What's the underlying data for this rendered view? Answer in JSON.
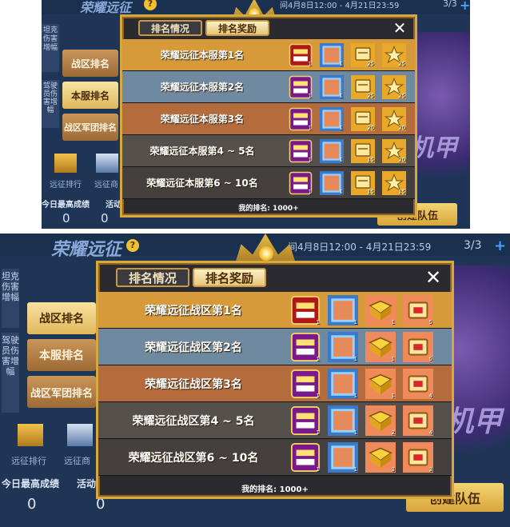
{
  "colors": {
    "row_gold": "#d69a3a",
    "row_slate": "#6f8aa0",
    "row_copper": "#b46c3c",
    "row_grey": "#55504c",
    "row_dark": "#45403d",
    "modal_gold": "#d8a840"
  },
  "top_screen": {
    "title": "荣耀远征",
    "time_range": "间4月8日12:00 - 4月21日23:59",
    "page_indicator": "3/3",
    "side_vertical_1": "坦克伤害增幅",
    "side_vertical_2": "驾驶员伤害增幅",
    "side_tabs": [
      "战区排名",
      "本服排名",
      "战区军团排名"
    ],
    "mini_icons": [
      "远征排行",
      "远征商"
    ],
    "stat_label": "今日最高成绩",
    "stat_label_2": "活动",
    "stat_value": "0",
    "team_button": "创建队伍",
    "mecha_text": "机甲",
    "modal": {
      "tabs": [
        "排名情况",
        "排名奖励"
      ],
      "close": "✕",
      "my_rank": "我的排名:  1000+",
      "rows": [
        {
          "title": "荣耀远征本服第1名",
          "rewards": [
            {
              "icon": "title-tianxia-icon",
              "count": "1"
            },
            {
              "icon": "frame-icon",
              "count": "1"
            },
            {
              "icon": "note-icon",
              "count": "25"
            },
            {
              "icon": "star-icon",
              "count": "25"
            }
          ]
        },
        {
          "title": "荣耀远征本服第2名",
          "rewards": [
            {
              "icon": "title-bazhu-icon",
              "count": "1"
            },
            {
              "icon": "frame-icon",
              "count": "1"
            },
            {
              "icon": "note-icon",
              "count": "25"
            },
            {
              "icon": "star-icon",
              "count": "25"
            }
          ]
        },
        {
          "title": "荣耀远征本服第3名",
          "rewards": [
            {
              "icon": "title-bazhu-icon",
              "count": "1"
            },
            {
              "icon": "frame-icon",
              "count": "1"
            },
            {
              "icon": "note-icon",
              "count": "20"
            },
            {
              "icon": "star-icon",
              "count": "20"
            }
          ]
        },
        {
          "title": "荣耀远征本服第4 ~ 5名",
          "rewards": [
            {
              "icon": "title-bazhu-icon",
              "count": "1"
            },
            {
              "icon": "frame-icon",
              "count": "1"
            },
            {
              "icon": "note-icon",
              "count": "15"
            },
            {
              "icon": "star-icon",
              "count": "20"
            }
          ]
        },
        {
          "title": "荣耀远征本服第6 ~ 10名",
          "rewards": [
            {
              "icon": "title-bazhu-icon",
              "count": "1"
            },
            {
              "icon": "frame-icon",
              "count": "1"
            },
            {
              "icon": "note-icon",
              "count": "15"
            },
            {
              "icon": "star-icon",
              "count": "15"
            }
          ]
        }
      ]
    }
  },
  "bottom_screen": {
    "title": "荣耀远征",
    "time_range": "间4月8日12:00 - 4月21日23:59",
    "page_indicator": "3/3",
    "side_vertical_1": "坦克伤害增幅",
    "side_vertical_2": "驾驶员伤害增幅",
    "side_tabs": [
      "战区排名",
      "本服排名",
      "战区军团排名"
    ],
    "mini_icons": [
      "远征排行",
      "远征商"
    ],
    "stat_label": "今日最高成绩",
    "stat_label_2": "活动",
    "stat_value": "0",
    "team_button": "创建队伍",
    "mecha_text": "机甲",
    "modal": {
      "tabs": [
        "排名情况",
        "排名奖励"
      ],
      "close": "✕",
      "my_rank": "我的排名:  1000+",
      "rows": [
        {
          "title": "荣耀远征战区第1名",
          "rewards": [
            {
              "icon": "title-tianxia-icon",
              "count": "1"
            },
            {
              "icon": "frame-icon",
              "count": "1"
            },
            {
              "icon": "book-icon",
              "count": "1"
            },
            {
              "icon": "chip-icon",
              "count": "5"
            }
          ]
        },
        {
          "title": "荣耀远征战区第2名",
          "rewards": [
            {
              "icon": "title-bazhu-icon",
              "count": "1"
            },
            {
              "icon": "frame-icon",
              "count": "1"
            },
            {
              "icon": "book-icon",
              "count": "1"
            },
            {
              "icon": "chip-icon",
              "count": "5"
            }
          ]
        },
        {
          "title": "荣耀远征战区第3名",
          "rewards": [
            {
              "icon": "title-bazhu-icon",
              "count": "1"
            },
            {
              "icon": "frame-icon",
              "count": "1"
            },
            {
              "icon": "book-icon",
              "count": "1"
            },
            {
              "icon": "chip-icon",
              "count": "4"
            }
          ]
        },
        {
          "title": "荣耀远征战区第4 ~ 5名",
          "rewards": [
            {
              "icon": "title-bazhu-icon",
              "count": "1"
            },
            {
              "icon": "frame-icon",
              "count": "1"
            },
            {
              "icon": "book-icon",
              "count": "2"
            },
            {
              "icon": "chip-icon",
              "count": "4"
            }
          ]
        },
        {
          "title": "荣耀远征战区第6 ~ 10名",
          "rewards": [
            {
              "icon": "title-bazhu-icon",
              "count": "1"
            },
            {
              "icon": "frame-icon",
              "count": "1"
            },
            {
              "icon": "book-icon",
              "count": "3"
            },
            {
              "icon": "chip-icon",
              "count": "3"
            }
          ]
        }
      ]
    }
  }
}
